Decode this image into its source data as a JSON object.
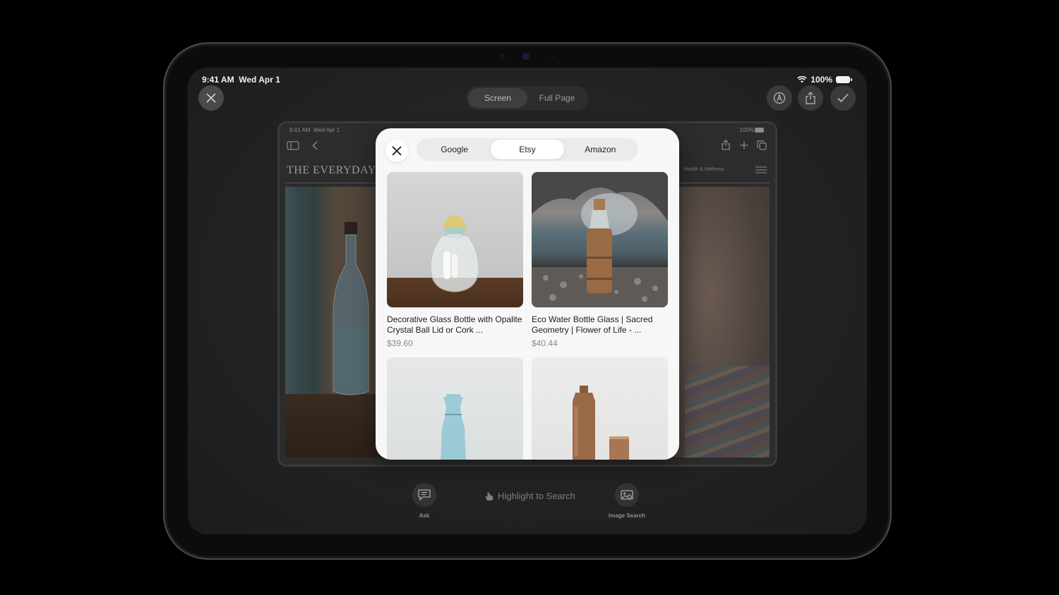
{
  "status_bar": {
    "time": "9:41 AM",
    "date": "Wed Apr 1",
    "battery": "100%"
  },
  "capture_mode": {
    "options": [
      "Screen",
      "Full Page"
    ],
    "selected": "Screen"
  },
  "captured_page": {
    "status_time": "9:41 AM",
    "status_date": "Wed Apr 1",
    "status_battery": "100%",
    "site_title": "THE EVERYDAY",
    "nav_text": "Health & Wellness"
  },
  "visual_search": {
    "tabs": [
      "Google",
      "Etsy",
      "Amazon"
    ],
    "active_tab": "Etsy",
    "results": [
      {
        "title": "Decorative Glass Bottle with Opalite Crystal Ball Lid or Cork ...",
        "price": "$39.60"
      },
      {
        "title": "Eco Water Bottle Glass | Sacred Geometry | Flower of Life - ...",
        "price": "$40.44"
      },
      {
        "title": "",
        "price": ""
      },
      {
        "title": "",
        "price": ""
      }
    ]
  },
  "bottom_tools": {
    "ask_label": "Ask",
    "highlight_label": "Highlight to Search",
    "image_search_label": "Image Search"
  },
  "icons": [
    "close-icon",
    "markup-icon",
    "share-icon",
    "checkmark-icon",
    "chat-icon",
    "hand-icon",
    "image-search-icon"
  ]
}
